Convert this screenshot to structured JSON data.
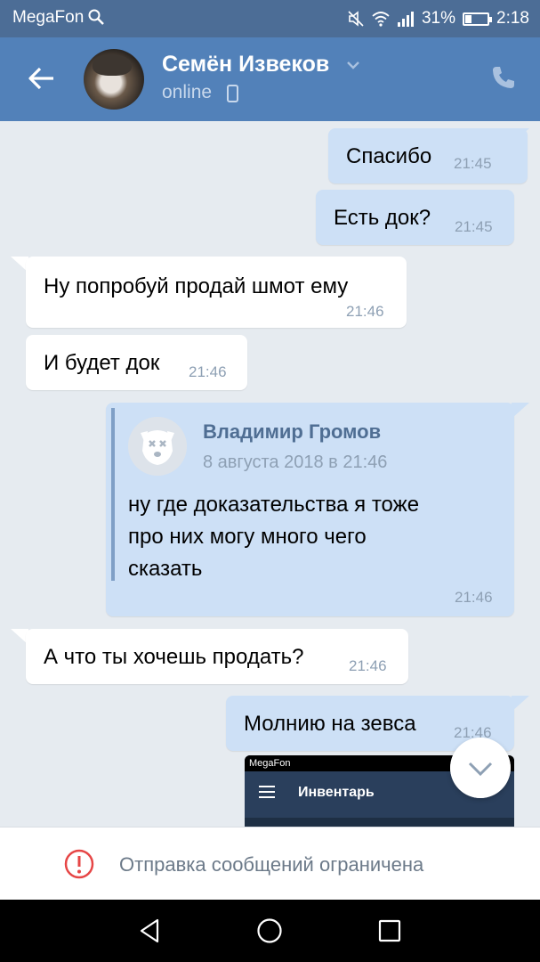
{
  "status_bar": {
    "carrier": "MegaFon",
    "battery_percent": "31%",
    "battery_level": 0.31,
    "time": "2:18"
  },
  "header": {
    "contact_name": "Семён Извеков",
    "status": "online"
  },
  "messages": [
    {
      "direction": "out",
      "text": "Спасибо",
      "time": "21:45"
    },
    {
      "direction": "out",
      "text": "Есть док?",
      "time": "21:45"
    },
    {
      "direction": "in",
      "text": "Ну попробуй продай шмот ему",
      "time": "21:46"
    },
    {
      "direction": "in",
      "text": "И будет док",
      "time": "21:46"
    },
    {
      "direction": "out",
      "type": "forward",
      "forward_from": "Владимир Громов",
      "forward_date": "8 августа 2018 в 21:46",
      "lines": [
        "ну где доказательства я тоже",
        "про них могу много чего",
        "сказать"
      ],
      "time": "21:46"
    },
    {
      "direction": "in",
      "text": "А что ты хочешь продать?",
      "time": "21:46"
    },
    {
      "direction": "out",
      "text": "Молнию на зевса",
      "time": "21:46"
    }
  ],
  "attachment_preview": {
    "carrier": "MegaFon",
    "title": "Инвентарь"
  },
  "restricted_notice": "Отправка сообщений ограничена",
  "colors": {
    "header": "#5281b9",
    "status_bar": "#4c6d96",
    "outgoing_bubble": "#cde0f6",
    "incoming_bubble": "#ffffff",
    "chat_background": "#e6ebf0",
    "warning": "#e64646"
  }
}
